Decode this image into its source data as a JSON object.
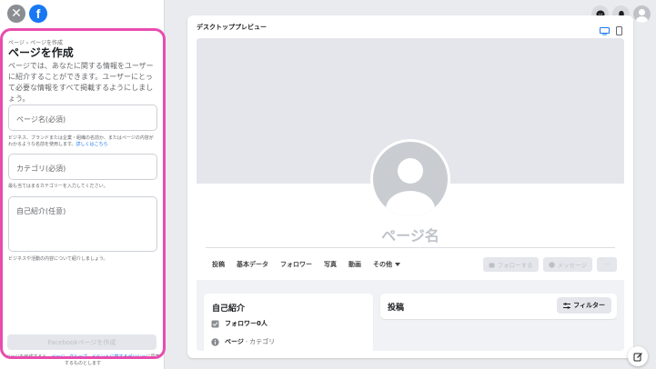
{
  "app": {
    "close_icon": "close-icon",
    "logo": "facebook-logo"
  },
  "form": {
    "breadcrumb": "ページ › ページを作成",
    "title": "ページを作成",
    "description": "ページでは、あなたに関する情報をユーザーに紹介することができます。ユーザーにとって必要な情報をすべて掲載するようにしましょう。",
    "page_name_placeholder": "ページ名(必須)",
    "page_name_hint": "ビジネス、ブランドまたは企業・組織の名前か、またはページの内容がわかるような名前を使用します。",
    "page_name_hint_link": "詳しくはこちら",
    "category_placeholder": "カテゴリ(必須)",
    "category_hint": "最も当てはまるカテゴリーを入力してください。",
    "bio_placeholder": "自己紹介(任意)",
    "bio_hint": "ビジネスや活動の内容について紹介しましょう。",
    "create_button": "Facebookページを作成",
    "terms_prefix": "ページを作成すると、",
    "terms_link": "ページ、グループ、イベントに関するポリシー",
    "terms_suffix": "に同意するものとします"
  },
  "top_icons": [
    "messenger-icon",
    "bell-icon",
    "avatar"
  ],
  "preview": {
    "title": "デスクトッププレビュー",
    "page_name": "ページ名",
    "tabs": [
      "投稿",
      "基本データ",
      "フォロワー",
      "写真",
      "動画"
    ],
    "tab_more": "その他",
    "follow_button": "フォローする",
    "message_button": "メッセージ",
    "more_button": "···",
    "intro_title": "自己紹介",
    "intro_followers": "フォロワー0人",
    "intro_page": "ページ",
    "intro_category": "カテゴリ",
    "posts_title": "投稿",
    "filter_button": "フィルター"
  },
  "colors": {
    "accent": "#1877f2",
    "highlight": "#e94cae"
  }
}
